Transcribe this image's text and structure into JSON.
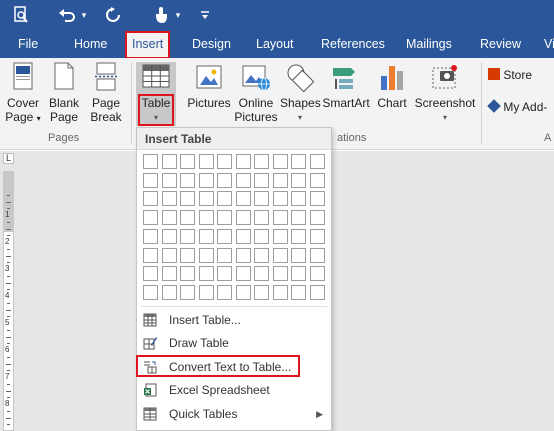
{
  "qat": {
    "items": [
      {
        "name": "print-preview-button",
        "icon": "print-preview-icon",
        "glyph": "⎙"
      },
      {
        "name": "undo-button",
        "icon": "undo-icon",
        "glyph": "↶"
      },
      {
        "name": "undo-dropdown",
        "icon": "chevron-down-icon",
        "glyph": "▾"
      },
      {
        "name": "redo-button",
        "icon": "redo-icon",
        "glyph": "↻"
      },
      {
        "name": "touch-mode-button",
        "icon": "touch-mode-icon",
        "glyph": "☝"
      },
      {
        "name": "touch-mode-dropdown",
        "icon": "chevron-down-icon",
        "glyph": "▾"
      },
      {
        "name": "customize-qat-button",
        "icon": "customize-icon",
        "glyph": "≡"
      }
    ]
  },
  "tabs": [
    "File",
    "Home",
    "Insert",
    "Design",
    "Layout",
    "References",
    "Mailings",
    "Review",
    "Vi"
  ],
  "active_tab": "Insert",
  "ribbon": {
    "cover_page": {
      "line1": "Cover",
      "line2": "Page"
    },
    "blank_page": {
      "line1": "Blank",
      "line2": "Page"
    },
    "page_break": {
      "line1": "Page",
      "line2": "Break"
    },
    "table": {
      "label": "Table"
    },
    "pictures": {
      "label": "Pictures"
    },
    "online_pictures": {
      "line1": "Online",
      "line2": "Pictures"
    },
    "shapes": {
      "label": "Shapes"
    },
    "smartart": {
      "label": "SmartArt"
    },
    "chart": {
      "label": "Chart"
    },
    "screenshot": {
      "label": "Screenshot"
    },
    "store": {
      "label": "Store"
    },
    "my_addins": {
      "label": "My Add-"
    },
    "groups": {
      "pages": "Pages",
      "illustrations_partial": "ations",
      "addins_partial": "A"
    }
  },
  "menu": {
    "header": "Insert Table",
    "grid": {
      "cols": 10,
      "rows": 8
    },
    "items": [
      {
        "label": "Insert Table...",
        "icon": "insert-table-icon",
        "submenu": false
      },
      {
        "label": "Draw Table",
        "icon": "draw-table-icon",
        "submenu": false
      },
      {
        "label": "Convert Text to Table...",
        "icon": "convert-text-to-table-icon",
        "submenu": false
      },
      {
        "label": "Excel Spreadsheet",
        "icon": "excel-spreadsheet-icon",
        "submenu": false
      },
      {
        "label": "Quick Tables",
        "icon": "quick-tables-icon",
        "submenu": true
      }
    ]
  },
  "ruler": {
    "corner": "L",
    "numbers": [
      "1",
      "2",
      "3",
      "4",
      "5",
      "6",
      "7",
      "8"
    ]
  },
  "colors": {
    "ribbon_blue": "#2b579a",
    "highlight_red": "#e0141e",
    "store_orange": "#d83b01"
  }
}
